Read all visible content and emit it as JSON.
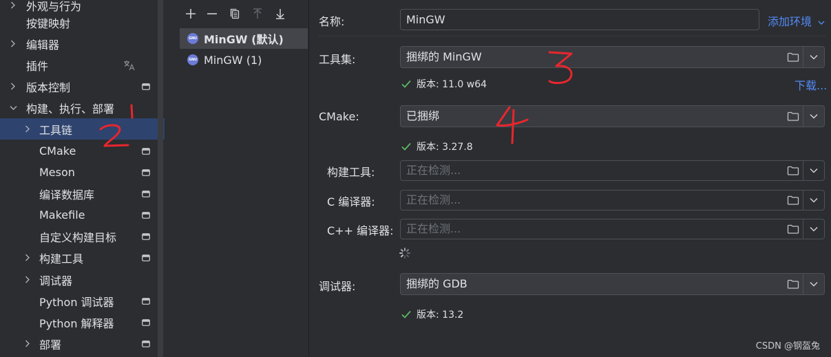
{
  "sidebar": {
    "items": [
      {
        "label": "外观与行为",
        "expandable": true,
        "expanded": false,
        "icon": null
      },
      {
        "label": "按键映射",
        "expandable": false,
        "icon": null
      },
      {
        "label": "编辑器",
        "expandable": true,
        "expanded": false,
        "icon": null
      },
      {
        "label": "插件",
        "expandable": false,
        "icon": "translate-icon"
      },
      {
        "label": "版本控制",
        "expandable": true,
        "expanded": false,
        "icon": "project-settings-icon"
      },
      {
        "label": "构建、执行、部署",
        "expandable": true,
        "expanded": true,
        "icon": null
      },
      {
        "label": "工具链",
        "expandable": true,
        "expanded": false,
        "selected": true,
        "icon": null
      },
      {
        "label": "CMake",
        "expandable": false,
        "icon": "project-settings-icon"
      },
      {
        "label": "Meson",
        "expandable": false,
        "icon": "project-settings-icon"
      },
      {
        "label": "编译数据库",
        "expandable": false,
        "icon": "project-settings-icon"
      },
      {
        "label": "Makefile",
        "expandable": false,
        "icon": "project-settings-icon"
      },
      {
        "label": "自定义构建目标",
        "expandable": false,
        "icon": "project-settings-icon"
      },
      {
        "label": "构建工具",
        "expandable": true,
        "expanded": false,
        "icon": "project-settings-icon"
      },
      {
        "label": "调试器",
        "expandable": true,
        "expanded": false,
        "icon": null
      },
      {
        "label": "Python 调试器",
        "expandable": false,
        "icon": "project-settings-icon"
      },
      {
        "label": "Python 解释器",
        "expandable": false,
        "icon": "project-settings-icon"
      },
      {
        "label": "部署",
        "expandable": true,
        "expanded": false,
        "icon": "project-settings-icon"
      }
    ]
  },
  "toolchains": {
    "toolbar": [
      "add-icon",
      "remove-icon",
      "copy-icon",
      "move-up-icon",
      "move-down-icon"
    ],
    "items": [
      {
        "label": "MinGW (默认)",
        "icon": "gnu-icon",
        "icon_text": "GNU",
        "selected": true
      },
      {
        "label": "MinGW (1)",
        "icon": "gnu-icon",
        "icon_text": "GNU",
        "selected": false
      }
    ]
  },
  "form": {
    "name": {
      "label": "名称:",
      "value": "MinGW",
      "add_env_link": "添加环境"
    },
    "toolset": {
      "label": "工具集:",
      "value": "捆绑的 MinGW",
      "status": "版本: 11.0 w64",
      "download_link": "下载..."
    },
    "cmake": {
      "label": "CMake:",
      "value": "已捆绑",
      "status": "版本: 3.27.8"
    },
    "build_tool": {
      "label": "构建工具:",
      "placeholder": "正在检测..."
    },
    "c_compiler": {
      "label": "C 编译器:",
      "placeholder": "正在检测..."
    },
    "cpp_compiler": {
      "label": "C++ 编译器:",
      "placeholder": "正在检测..."
    },
    "debugger": {
      "label": "调试器:",
      "value": "捆绑的 GDB",
      "status": "版本: 13.2"
    }
  },
  "annotations": [
    "1",
    "2",
    "3",
    "4"
  ],
  "colors": {
    "accent": "#548af7",
    "selection": "#2e436e",
    "check": "#5fb865",
    "annotation": "#e8262d"
  },
  "watermark": "CSDN @钢盔兔"
}
